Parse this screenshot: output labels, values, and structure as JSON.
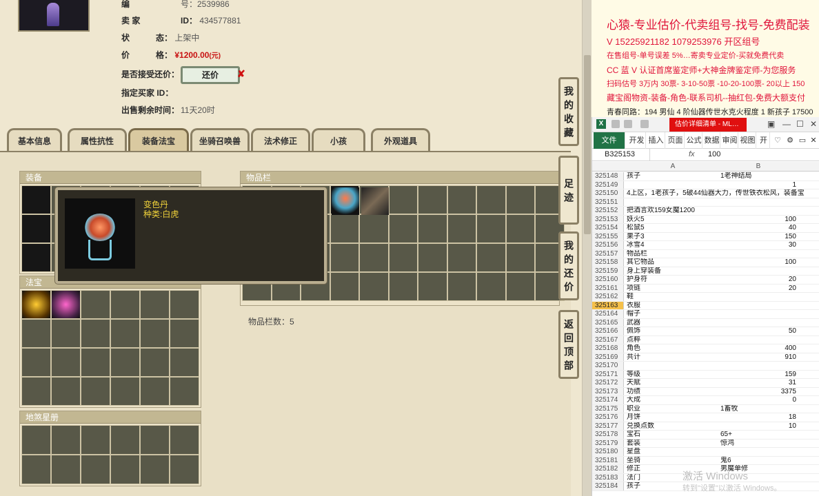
{
  "seller": {
    "id_prefix_label": "编",
    "id_prefix_value": "号：2539986",
    "rows": [
      {
        "label": "卖 家",
        "sep": "ID：",
        "value": "434577881"
      },
      {
        "label": "状",
        "sep": "态：",
        "value": "上架中"
      },
      {
        "label": "价",
        "sep": "格：",
        "value": "¥1200.00",
        "unit": "(元)"
      }
    ],
    "haggle_label": "是否接受还价：",
    "haggle_button": "还价",
    "designated_buyer_label": "指定买家 ID：",
    "remaining_label": "出售剩余时间：",
    "remaining_value": "11天20时"
  },
  "tabs": [
    "基本信息",
    "属性抗性",
    "装备法宝",
    "坐骑召唤兽",
    "法术修正",
    "小孩",
    "外观道具"
  ],
  "active_tab": 2,
  "panels": {
    "equipment": "装备",
    "treasure": "法宝",
    "constellation": "地煞星册",
    "inventory": "物品栏",
    "inventory_count": "物品栏数：5"
  },
  "tooltip": {
    "name": "变色丹",
    "type": "种类:白虎"
  },
  "side_buttons": [
    "我的收藏",
    "足迹",
    "我的还价",
    "返回顶部"
  ],
  "ad": {
    "title": "心猿-专业估价-代卖组号-找号-免费配装",
    "line1": "V 15225921182  1079253976 开区组号",
    "line2": "在售组号-单号误差 5%…寄卖专业定价-买就免费代卖",
    "line3": "CC 蓝 V 认证首席鉴定师+大神金牌鉴定师-为您服务",
    "line4": "扫码估号 3万内 30票- 3-10-50票 -10-20-100票- 20以上 150",
    "line5": "藏宝阁物资-装备-角色-联系司机--抽红包-免费大额支付",
    "line6": "青春同路：194 男仙 4 阶仙器传世水克火程度 1 新孩子 17500"
  },
  "excel": {
    "alert": "估价详细清单 - ML…",
    "tabs": [
      "文件",
      "开发",
      "插入",
      "页面",
      "公式",
      "数据",
      "审阅",
      "视图",
      "开"
    ],
    "name_box": "B325153",
    "fx": "fx",
    "formula_value": "100",
    "col_a": "A",
    "col_b": "B",
    "rows": [
      {
        "n": "325148",
        "a": "孩子",
        "b": "1老神结局"
      },
      {
        "n": "325149",
        "a": "",
        "b": "1"
      },
      {
        "n": "325150",
        "a": "4上区，1老孩子，5破44仙器大力，传世铁衣松风，装备宝",
        "b": ""
      },
      {
        "n": "325151",
        "a": "",
        "b": ""
      },
      {
        "n": "325152",
        "a": "把酒言欢159女魔1200",
        "b": ""
      },
      {
        "n": "325153",
        "a": "妖火5",
        "b": "100"
      },
      {
        "n": "325154",
        "a": "松鼠5",
        "b": "40"
      },
      {
        "n": "325155",
        "a": "果子3",
        "b": "150"
      },
      {
        "n": "325156",
        "a": "冰雪4",
        "b": "30"
      },
      {
        "n": "325157",
        "a": "物品栏",
        "b": ""
      },
      {
        "n": "325158",
        "a": "其它物品",
        "b": "100"
      },
      {
        "n": "325159",
        "a": "身上穿装备",
        "b": ""
      },
      {
        "n": "325160",
        "a": "护身符",
        "b": "20"
      },
      {
        "n": "325161",
        "a": "项链",
        "b": "20"
      },
      {
        "n": "325162",
        "a": "鞋",
        "b": ""
      },
      {
        "n": "325163",
        "a": "衣服",
        "b": ""
      },
      {
        "n": "325164",
        "a": "帽子",
        "b": ""
      },
      {
        "n": "325165",
        "a": "武器",
        "b": ""
      },
      {
        "n": "325166",
        "a": "佩饰",
        "b": "50"
      },
      {
        "n": "325167",
        "a": "点粹",
        "b": ""
      },
      {
        "n": "325168",
        "a": "角色",
        "b": "400"
      },
      {
        "n": "325169",
        "a": "共计",
        "b": "910"
      },
      {
        "n": "325170",
        "a": "",
        "b": ""
      },
      {
        "n": "325171",
        "a": "等级",
        "b": "159"
      },
      {
        "n": "325172",
        "a": "天赋",
        "b": "31"
      },
      {
        "n": "325173",
        "a": "功绩",
        "b": "3375"
      },
      {
        "n": "325174",
        "a": "大成",
        "b": "0"
      },
      {
        "n": "325175",
        "a": "职业",
        "b": "1畜牧"
      },
      {
        "n": "325176",
        "a": "月饼",
        "b": "18"
      },
      {
        "n": "325177",
        "a": "兑换点数",
        "b": "10"
      },
      {
        "n": "325178",
        "a": "宝石",
        "b": "65+"
      },
      {
        "n": "325179",
        "a": "套装",
        "b": "惊鸿"
      },
      {
        "n": "325180",
        "a": "星盘",
        "b": ""
      },
      {
        "n": "325181",
        "a": "坐骑",
        "b": "鬼6"
      },
      {
        "n": "325182",
        "a": "修正",
        "b": "男魔单修"
      },
      {
        "n": "325183",
        "a": "法门",
        "b": ""
      },
      {
        "n": "325184",
        "a": "孩子",
        "b": ""
      }
    ],
    "selected_row": "325163"
  },
  "watermark": {
    "line1": "激活 Windows",
    "line2": "转到\"设置\"以激活 Windows。"
  }
}
